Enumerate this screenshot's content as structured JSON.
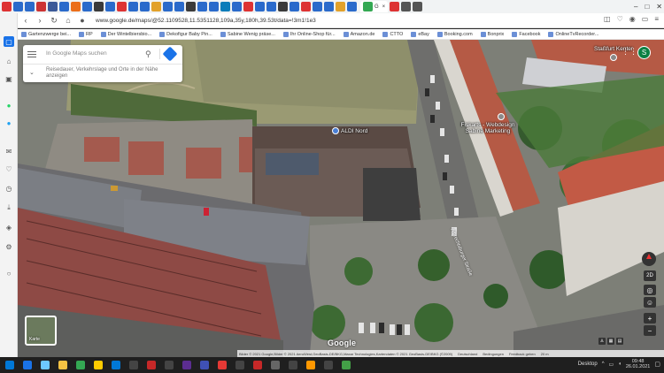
{
  "browser": {
    "active_tab_label": "G",
    "url": "www.google.de/maps/@52.1109528,11.5351128,109a,35y,180h,39.53t/data=!3m1!1e3",
    "tab_colors": [
      "#d33",
      "#2a6acb",
      "#2a6acb",
      "#c33",
      "#3b5998",
      "#2a6acb",
      "#eb6e1a",
      "#2a6acb",
      "#3a3a3a",
      "#2a6acb",
      "#d33",
      "#2a6acb",
      "#2a6acb",
      "#e2a12a",
      "#2a6acb",
      "#2a6acb",
      "#3a3a3a",
      "#2a6acb",
      "#2a6acb",
      "#0a7cba",
      "#2a6acb",
      "#d33",
      "#2a6acb",
      "#2a6acb",
      "#3a3a3a",
      "#2a6acb",
      "#d33",
      "#2a6acb",
      "#2a6acb",
      "#e2a12a",
      "#2a6acb",
      "#d33",
      "#555",
      "#555"
    ]
  },
  "bookmarks": [
    {
      "label": "Gartenzwerge bei..."
    },
    {
      "label": "RP"
    },
    {
      "label": "Der Wintelbiersbio..."
    },
    {
      "label": "Dekofigur Baby Pin..."
    },
    {
      "label": "Sabine Wenig präse..."
    },
    {
      "label": "Ihr Online-Shop für..."
    },
    {
      "label": "Amazon.de"
    },
    {
      "label": "CTTO"
    },
    {
      "label": "eBay"
    },
    {
      "label": "Booking.com"
    },
    {
      "label": "Bonprix"
    },
    {
      "label": "Facebook"
    },
    {
      "label": "OnlineTvRecorder..."
    }
  ],
  "search": {
    "placeholder": "In Google Maps suchen",
    "hint": "Reisedauer, Verkehrslage und Orte in der Nähe anzeigen"
  },
  "map": {
    "pois": [
      {
        "label": "ALDI Nord"
      },
      {
        "label": "Fiskarts - Webdesign Sabine Marketing"
      },
      {
        "label": "Staßfurt Kenter"
      }
    ],
    "road_label": "Albrechtsburger Straße",
    "avatar_letter": "S",
    "mode_label": "2D",
    "minimap_label": "Karte",
    "logo": "Google",
    "attribution": [
      "Bilder © 2021 Google,Bilder © 2021 AeroWest,GeoBasis-DE/BKG,Maxar Technologies,Kartendaten © 2021 GeoBasis-DE/BKG (©2009)",
      "Deutschland",
      "Bedingungen",
      "Feedback geben",
      "20 m"
    ]
  },
  "taskbar": {
    "desktop_label": "Desktop",
    "time": "09:48",
    "date": "26.01.2021",
    "icon_colors": [
      "#1a73e8",
      "#6dc8ff",
      "#f6c343",
      "#34a853",
      "#ffcc00",
      "#0078d7",
      "#444",
      "#c62828",
      "#444",
      "#5c2d91",
      "#3f51b5",
      "#e53935",
      "#444",
      "#c62828",
      "#666",
      "#444",
      "#ff9800",
      "#444",
      "#43a047"
    ]
  }
}
